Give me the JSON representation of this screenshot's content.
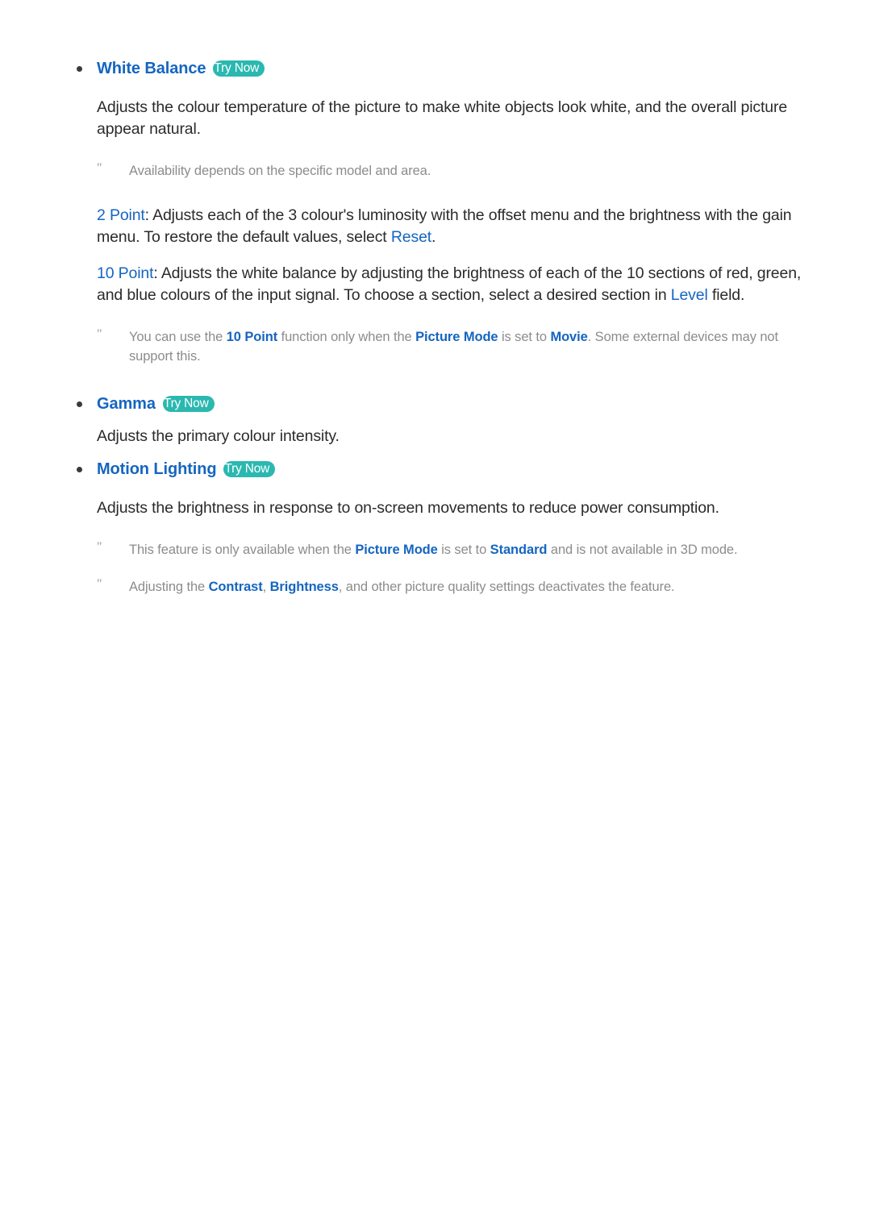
{
  "page": {
    "background": "#ffffff",
    "heading_color": "#1565c0",
    "badge_color": "#2ab8b0",
    "body_color": "#2b2b2b",
    "note_color": "#8c8c8c"
  },
  "badge_label": "Try Now",
  "sections": [
    {
      "title": "White Balance",
      "badge": "Try Now",
      "body": "Adjusts the colour temperature of the picture to make white objects look white, and the overall picture appear natural."
    },
    {
      "title": "Gamma",
      "badge": "Try Now",
      "body": "Adjusts the primary colour intensity."
    },
    {
      "title": "Motion Lighting",
      "badge": "Try Now",
      "body": "Adjusts the brightness in response to on-screen movements to reduce power consumption."
    }
  ],
  "notes": {
    "white_balance_availability": "Availability depends on the specific model and area.",
    "ten_point_note": {
      "p1": "You can use the ",
      "t1": "10 Point",
      "p2": " function only when the ",
      "t2": "Picture Mode",
      "p3": " is set to ",
      "t3": "Movie",
      "p4": ". Some external devices may not support this."
    },
    "motion_lighting_note_1": {
      "p1": "This feature is only available when the ",
      "t1": "Picture Mode",
      "p2": " is set to ",
      "t2": "Standard",
      "p3": " and is not available in 3D mode."
    },
    "motion_lighting_note_2": {
      "p1": "Adjusting the ",
      "t1": "Contrast",
      "p2": ", ",
      "t2": "Brightness",
      "p3": ", and other picture quality settings deactivates the feature."
    }
  },
  "paragraphs": {
    "two_point": {
      "label": "2 Point",
      "p1": ": Adjusts each of the 3 colour's luminosity with the offset menu and the brightness with the gain menu. To restore the default values, select ",
      "link": "Reset",
      "p2": "."
    },
    "ten_point": {
      "label": "10 Point",
      "p1": ": Adjusts the white balance by adjusting the brightness of each of the 10 sections of red, green, and blue colours of the input signal. To choose a section, select a desired section in ",
      "link": "Level",
      "p2": " field."
    }
  },
  "icons": {
    "bullet": "bullet-dot-icon",
    "note_marker": "note-quote-marker-icon"
  }
}
